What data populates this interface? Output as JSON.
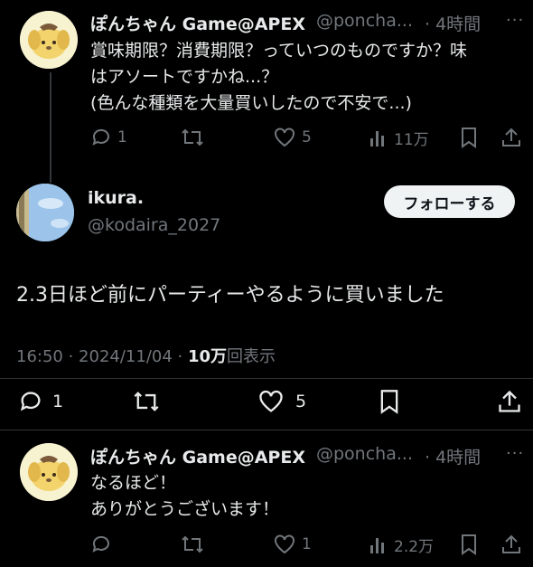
{
  "tweet1": {
    "name": "ぽんちゃん Game@APEX",
    "handle": "@poncha...",
    "time": "· 4時間",
    "more": "···",
    "text": "賞味期限？消費期限？っていつのものですか？味\nはアソートですかね...？\n(色んな種類を大量買いしたので不安で...)",
    "replies": "1",
    "likes": "5",
    "views": "11万"
  },
  "main": {
    "name": "ikura.",
    "handle": "@kodaira_2027",
    "follow_label": "フォローする",
    "text": "2.3日ほど前にパーティーやるように買いました",
    "time": "16:50 · 2024/11/04 · ",
    "views_count": "10万",
    "views_label": "回表示",
    "replies": "1",
    "likes": "5"
  },
  "tweet3": {
    "name": "ぽんちゃん Game@APEX",
    "handle": "@poncha...",
    "time": "· 4時間",
    "more": "···",
    "text": "なるほど！\nありがとうございます！",
    "likes": "1",
    "views": "2.2万"
  },
  "icons": [
    "reply-icon",
    "retweet-icon",
    "like-icon",
    "views-icon",
    "bookmark-icon",
    "share-icon",
    "more-icon"
  ],
  "colors": {
    "background": "#000000",
    "text": "#e7e9ea",
    "muted": "#71767b",
    "follow_bg": "#eff3f4"
  }
}
